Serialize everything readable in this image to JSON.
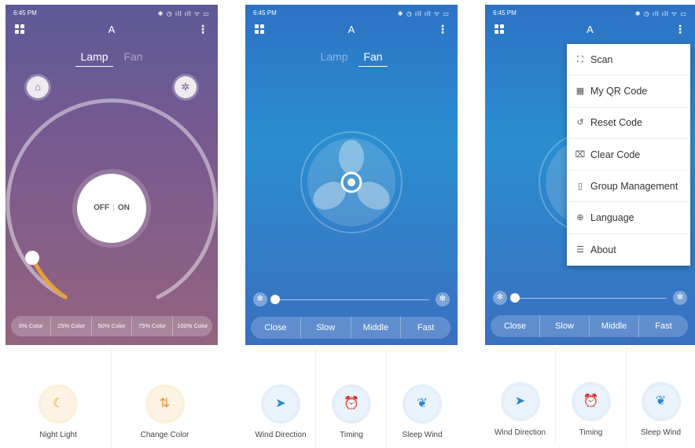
{
  "status": {
    "time": "6:45 PM",
    "icons": "✱ ◷ ıll ıll ᯤ ▭"
  },
  "app_title": "A",
  "tabs": {
    "lamp": "Lamp",
    "fan": "Fan"
  },
  "lamp": {
    "off_label": "OFF",
    "on_label": "ON",
    "color_presets": [
      "0% Color",
      "25% Color",
      "50% Color",
      "75% Color",
      "100% Color"
    ],
    "brightness_fraction": 0.1,
    "colors": {
      "arc_fill": "#e5a23b"
    }
  },
  "fan": {
    "speeds": [
      "Close",
      "Slow",
      "Middle",
      "Fast"
    ],
    "speed_fraction": 0.0
  },
  "menu": {
    "items": [
      {
        "label": "Scan",
        "icon": "scan-icon"
      },
      {
        "label": "My QR Code",
        "icon": "qr-code-icon"
      },
      {
        "label": "Reset Code",
        "icon": "reset-icon"
      },
      {
        "label": "Clear Code",
        "icon": "clear-icon"
      },
      {
        "label": "Group Management",
        "icon": "group-icon"
      },
      {
        "label": "Language",
        "icon": "globe-icon"
      },
      {
        "label": "About",
        "icon": "about-icon"
      }
    ]
  },
  "features": {
    "night_light": "Night Light",
    "change_color": "Change Color",
    "wind_direction": "Wind Direction",
    "timing": "Timing",
    "sleep_wind": "Sleep Wind"
  }
}
